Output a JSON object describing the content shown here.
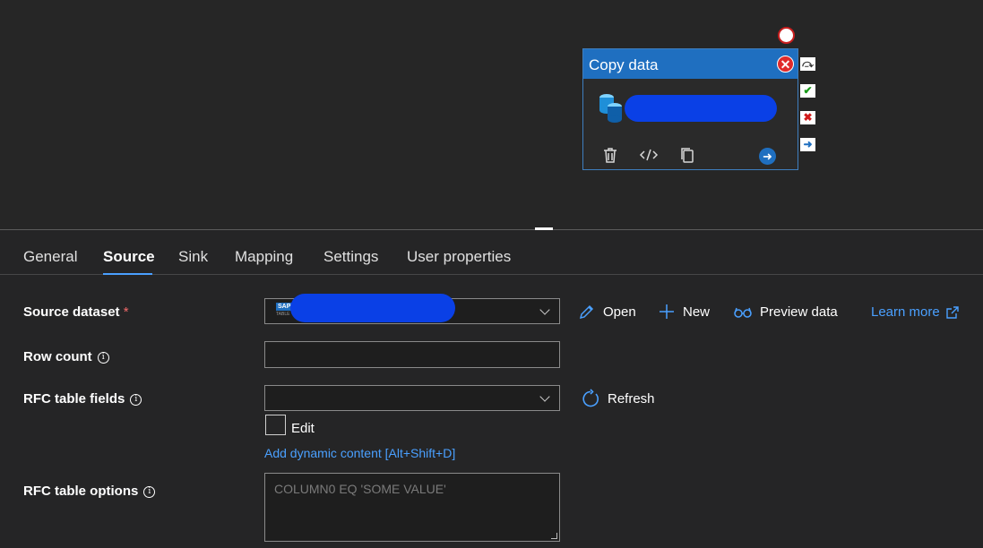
{
  "canvas": {
    "activity": {
      "title": "Copy data",
      "name_redacted": true
    }
  },
  "tabs": [
    "General",
    "Source",
    "Sink",
    "Mapping",
    "Settings",
    "User properties"
  ],
  "active_tab": "Source",
  "form": {
    "source_dataset": {
      "label": "Source dataset",
      "required_mark": "*",
      "sap_badge_text": "SAP",
      "sap_badge_sub": "TABLE"
    },
    "actions": {
      "open": "Open",
      "new": "New",
      "preview": "Preview data",
      "learn_more": "Learn more"
    },
    "row_count": {
      "label": "Row count",
      "value": ""
    },
    "rfc_table_fields": {
      "label": "RFC table fields",
      "value": "",
      "refresh": "Refresh",
      "edit_label": "Edit",
      "dynamic_content": "Add dynamic content [Alt+Shift+D]"
    },
    "rfc_table_options": {
      "label": "RFC table options",
      "placeholder": "COLUMN0 EQ 'SOME VALUE'"
    }
  },
  "colors": {
    "accent": "#4aa0ff",
    "activity_header": "#1f6fc0",
    "redaction": "#0a40e6",
    "required": "#f26a6a"
  }
}
